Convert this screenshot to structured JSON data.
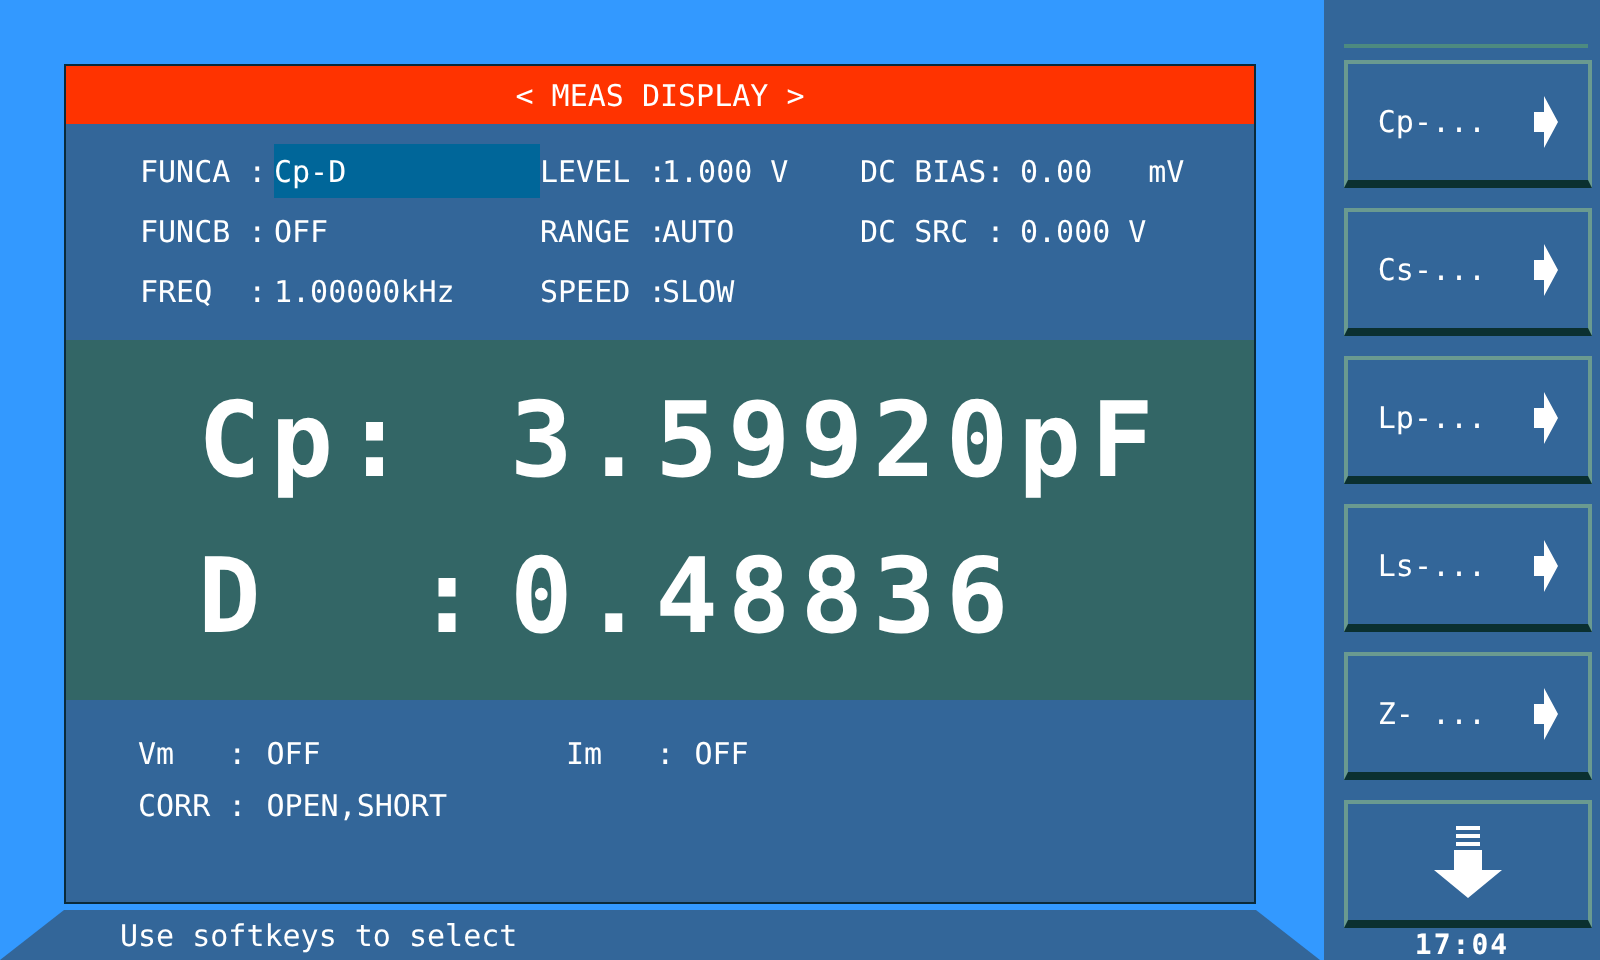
{
  "header": {
    "title": "< MEAS DISPLAY >"
  },
  "params": [
    [
      {
        "label": "FUNCA :",
        "value": "Cp-D",
        "selected": true
      },
      {
        "label": "LEVEL :",
        "value": "1.000 V",
        "selected": false
      },
      {
        "label": "DC BIAS:",
        "value": "0.00",
        "unit": "mV",
        "selected": false
      }
    ],
    [
      {
        "label": "FUNCB :",
        "value": "OFF",
        "selected": false
      },
      {
        "label": "RANGE :",
        "value": "AUTO",
        "selected": false
      },
      {
        "label": "DC SRC :",
        "value": "0.000 V",
        "selected": false
      }
    ],
    [
      {
        "label": "FREQ  :",
        "value": "1.00000kHz",
        "selected": false
      },
      {
        "label": "SPEED :",
        "value": "SLOW",
        "selected": false
      }
    ]
  ],
  "readouts": [
    {
      "label": "Cp:",
      "value": "3.59920pF"
    },
    {
      "label": "D  :",
      "value": "0.48836"
    }
  ],
  "monitors": [
    [
      {
        "label": "Vm   :",
        "value": "OFF"
      },
      {
        "label": "Im   :",
        "value": "OFF"
      }
    ],
    [
      {
        "label": "CORR :",
        "value": "OPEN,SHORT"
      }
    ]
  ],
  "status_bar": "Use softkeys to select",
  "softkeys": [
    {
      "kind": "arrow",
      "label": "Cp-..."
    },
    {
      "kind": "arrow",
      "label": "Cs-..."
    },
    {
      "kind": "arrow",
      "label": "Lp-..."
    },
    {
      "kind": "arrow",
      "label": "Ls-..."
    },
    {
      "kind": "arrow",
      "label": "Z- ..."
    },
    {
      "kind": "more"
    }
  ],
  "clock": "17:04"
}
